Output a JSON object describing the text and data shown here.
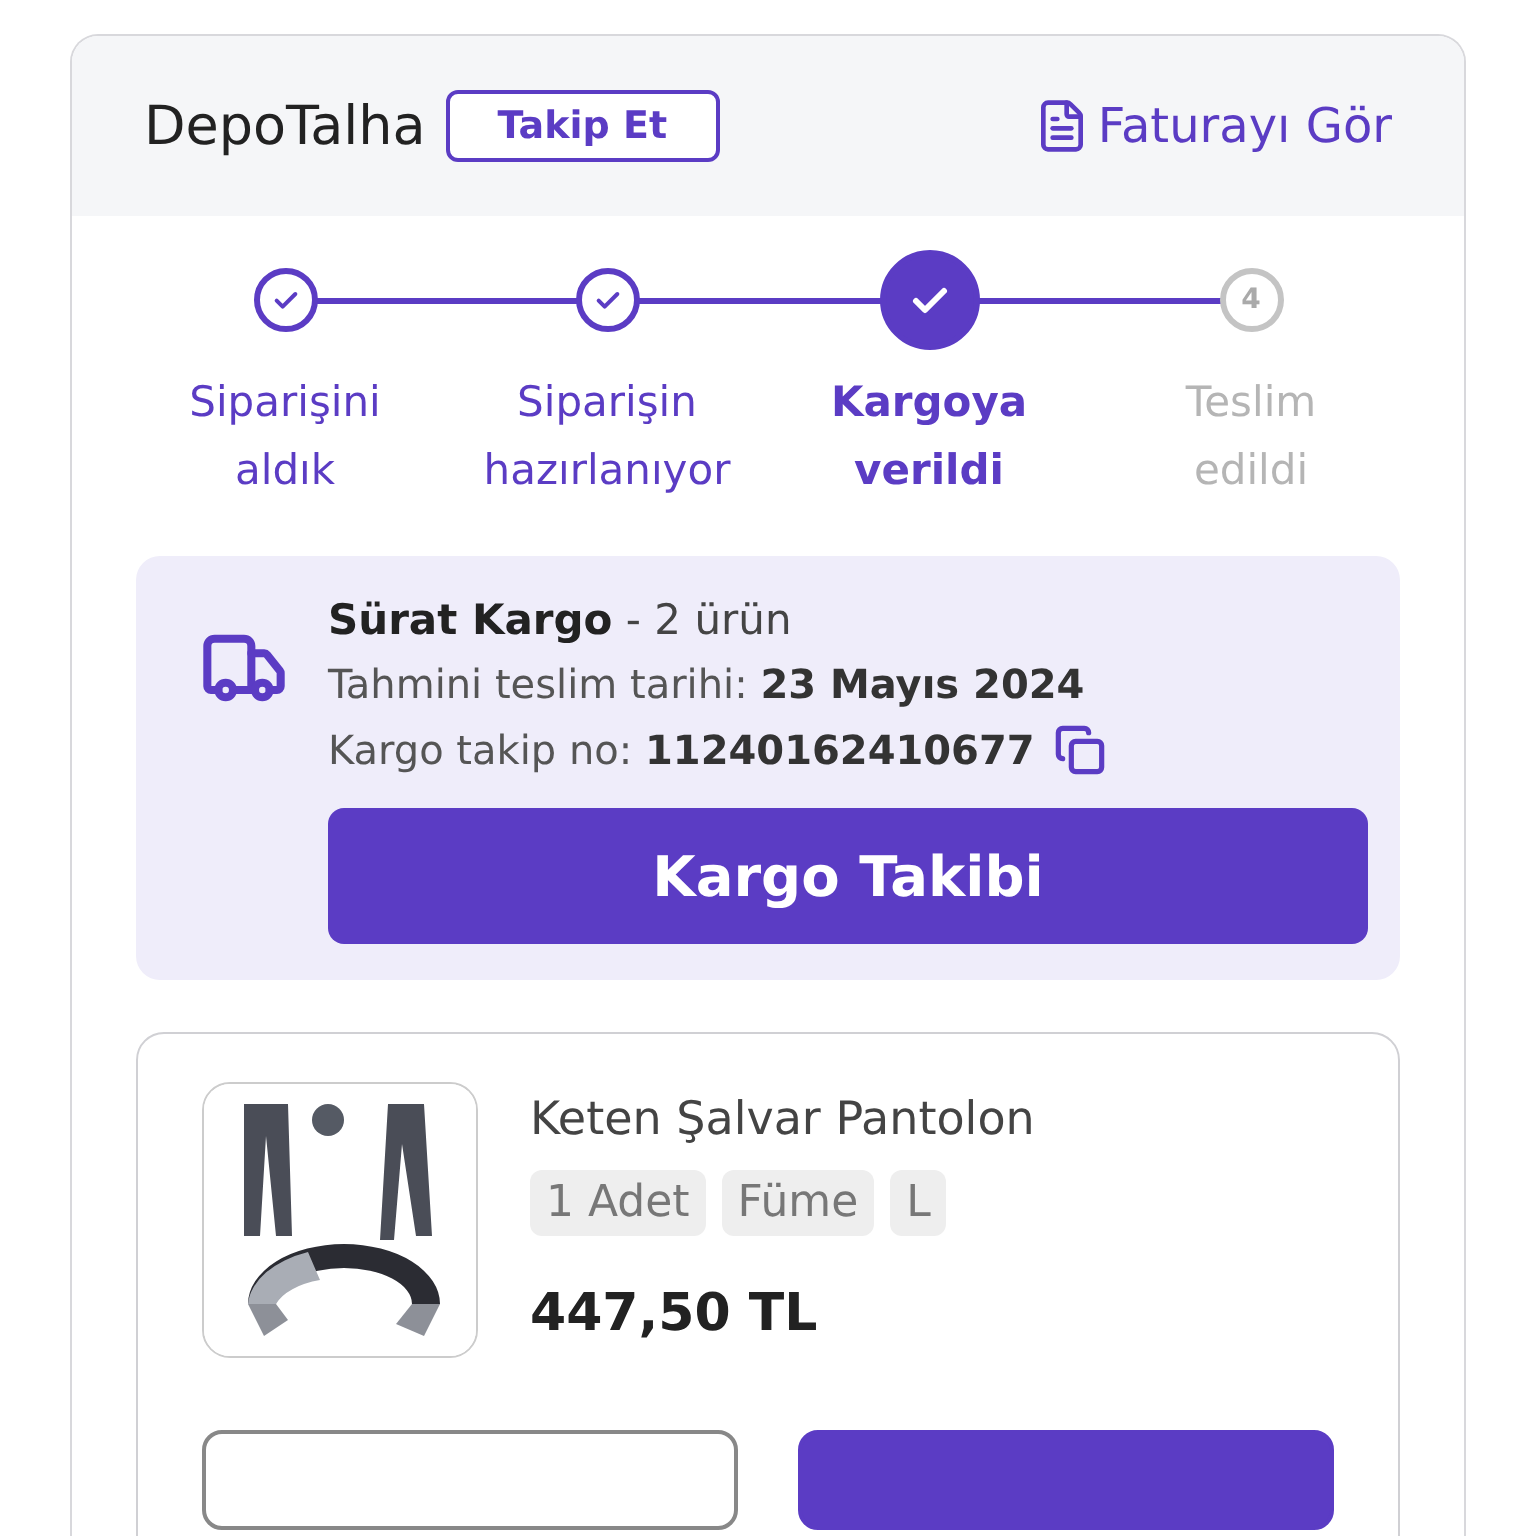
{
  "header": {
    "store_name": "DepoTalha",
    "follow_button": "Takip Et",
    "invoice_link": "Faturayı Gör"
  },
  "steps": [
    {
      "label": "Siparişini aldık",
      "kind": "done"
    },
    {
      "label": "Siparişin hazırlanıyor",
      "kind": "done"
    },
    {
      "label": "Kargoya verildi",
      "kind": "current"
    },
    {
      "label": "Teslim edildi",
      "kind": "pending",
      "number": "4"
    }
  ],
  "shipment": {
    "carrier": "Sürat Kargo",
    "item_count": "- 2 ürün",
    "delivery_label": "Tahmini teslim tarihi:",
    "delivery_date": "23 Mayıs 2024",
    "tracking_label": "Kargo takip no:",
    "tracking_number": "11240162410677",
    "track_button": "Kargo Takibi"
  },
  "product": {
    "image": {
      "kind": "picture"
    },
    "name": "Keten Şalvar Pantolon",
    "tags": [
      "1 Adet",
      "Füme",
      "L"
    ],
    "price": "447,50 TL"
  },
  "bottom_buttons": [
    {
      "kind": "outline"
    },
    {
      "kind": "filled"
    }
  ]
}
